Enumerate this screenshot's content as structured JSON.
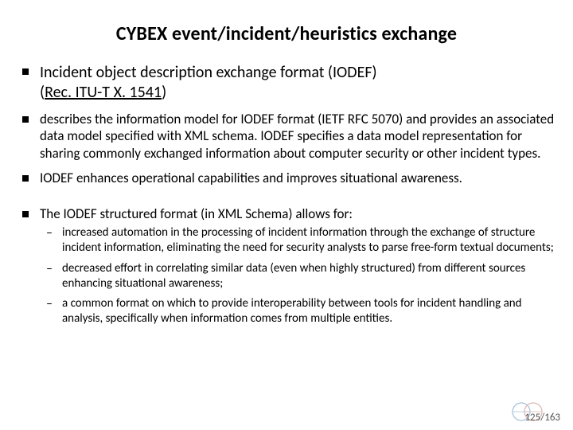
{
  "title": "CYBEX event/incident/heuristics exchange",
  "bullets": {
    "b1_line1": "Incident object description exchange format (IODEF)",
    "b1_paren_open": "(",
    "b1_link": "Rec. ITU-T X. 1541",
    "b1_paren_close": ")",
    "b2": "describes the information model for IODEF format (IETF RFC 5070) and provides an associated data model specified with XML schema. IODEF specifies a data model representation for sharing commonly exchanged information about computer security or other incident types.",
    "b3": "IODEF enhances operational capabilities and improves situational awareness.",
    "b4": "The IODEF structured format (in XML Schema) allows for:",
    "sub1": "increased automation in the processing of incident information through the exchange of structure incident information, eliminating the need for security analysts to parse free-form textual documents;",
    "sub2": "decreased effort in correlating similar data (even when highly structured) from different sources enhancing situational awareness;",
    "sub3": "a common format on which to provide interoperability between tools for incident handling and analysis, specifically when information comes from multiple entities."
  },
  "footer": {
    "page": "125/163"
  }
}
